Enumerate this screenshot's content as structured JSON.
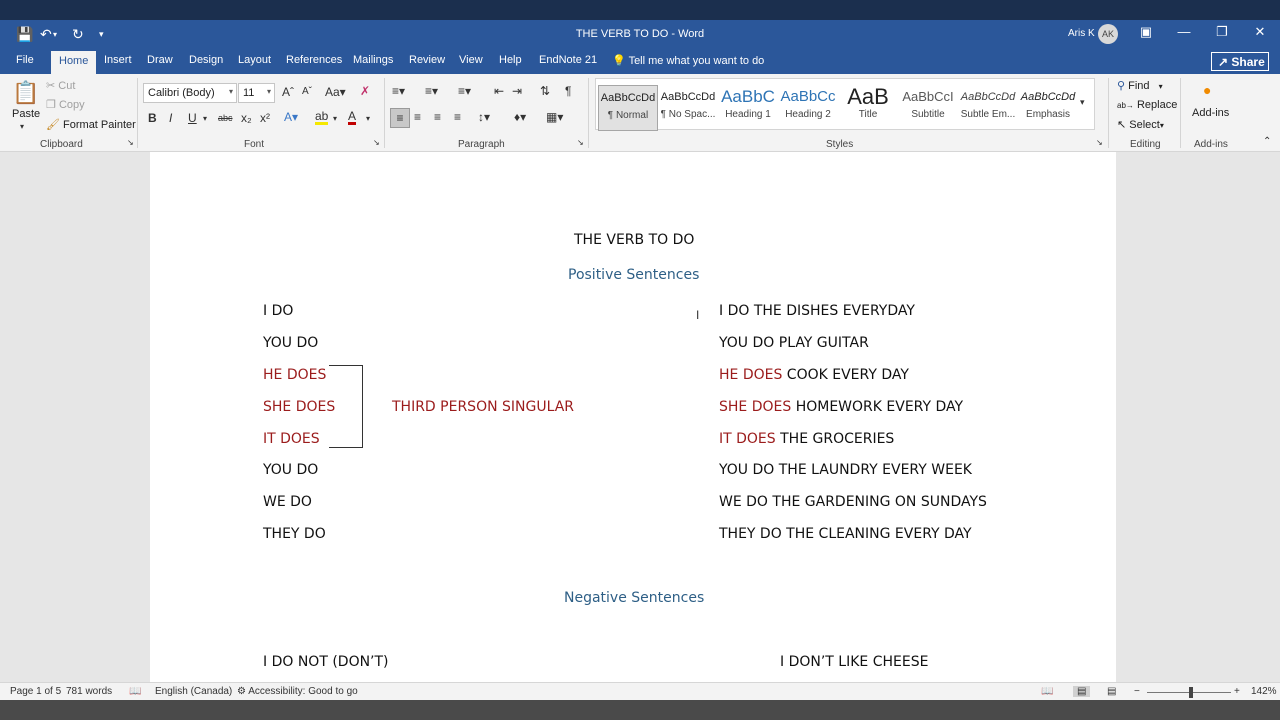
{
  "window": {
    "doc_title": "THE VERB TO DO  -  Word",
    "user_name": "Aris K",
    "user_initials": "AK"
  },
  "tabs": [
    "File",
    "Home",
    "Insert",
    "Draw",
    "Design",
    "Layout",
    "References",
    "Mailings",
    "Review",
    "View",
    "Help",
    "EndNote 21"
  ],
  "tell_me": "Tell me what you want to do",
  "share_label": "Share",
  "ribbon": {
    "clipboard": {
      "paste": "Paste",
      "cut": "Cut",
      "copy": "Copy",
      "format_painter": "Format Painter",
      "label": "Clipboard"
    },
    "font": {
      "font_name": "Calibri (Body)",
      "font_size": "11",
      "label": "Font"
    },
    "paragraph": {
      "label": "Paragraph"
    },
    "styles": {
      "label": "Styles",
      "items": [
        {
          "preview": "AaBbCcDd",
          "name": "¶ Normal"
        },
        {
          "preview": "AaBbCcDd",
          "name": "¶ No Spac..."
        },
        {
          "preview": "AaBbC",
          "name": "Heading 1"
        },
        {
          "preview": "AaBbCc",
          "name": "Heading 2"
        },
        {
          "preview": "AaB",
          "name": "Title"
        },
        {
          "preview": "AaBbCcI",
          "name": "Subtitle"
        },
        {
          "preview": "AaBbCcDd",
          "name": "Subtle Em..."
        },
        {
          "preview": "AaBbCcDd",
          "name": "Emphasis"
        }
      ]
    },
    "editing": {
      "find": "Find",
      "replace": "Replace",
      "select": "Select",
      "label": "Editing"
    },
    "addins": {
      "button": "Add-ins",
      "label": "Add-ins"
    }
  },
  "document": {
    "title": "THE VERB TO DO",
    "heading_positive": "Positive Sentences",
    "heading_negative": "Negative Sentences",
    "third_person_note": "THIRD PERSON SINGULAR",
    "left_column": [
      {
        "text": "I DO"
      },
      {
        "text": "YOU DO"
      },
      {
        "text": "HE DOES"
      },
      {
        "text": "SHE DOES"
      },
      {
        "text": "IT DOES"
      },
      {
        "text": "YOU DO"
      },
      {
        "text": "WE DO"
      },
      {
        "text": "THEY DO"
      }
    ],
    "right_column": [
      {
        "red": "",
        "rest": "I DO THE DISHES EVERYDAY"
      },
      {
        "red": "",
        "rest": "YOU DO PLAY GUITAR"
      },
      {
        "red": "HE DOES",
        "rest": " COOK EVERY DAY"
      },
      {
        "red": "SHE DOES",
        "rest": " HOMEWORK EVERY DAY"
      },
      {
        "red": "IT DOES",
        "rest": " THE GROCERIES"
      },
      {
        "red": "",
        "rest": "YOU DO THE LAUNDRY EVERY WEEK"
      },
      {
        "red": "",
        "rest": "WE DO THE GARDENING ON SUNDAYS"
      },
      {
        "red": "",
        "rest": "THEY DO THE CLEANING EVERY DAY"
      }
    ],
    "negative_left": "I DO NOT (DON’T)",
    "negative_right": "I DON’T LIKE CHEESE"
  },
  "status": {
    "page": "Page 1 of 5",
    "words": "781 words",
    "language": "English (Canada)",
    "accessibility": "Accessibility: Good to go",
    "zoom": "142%"
  }
}
